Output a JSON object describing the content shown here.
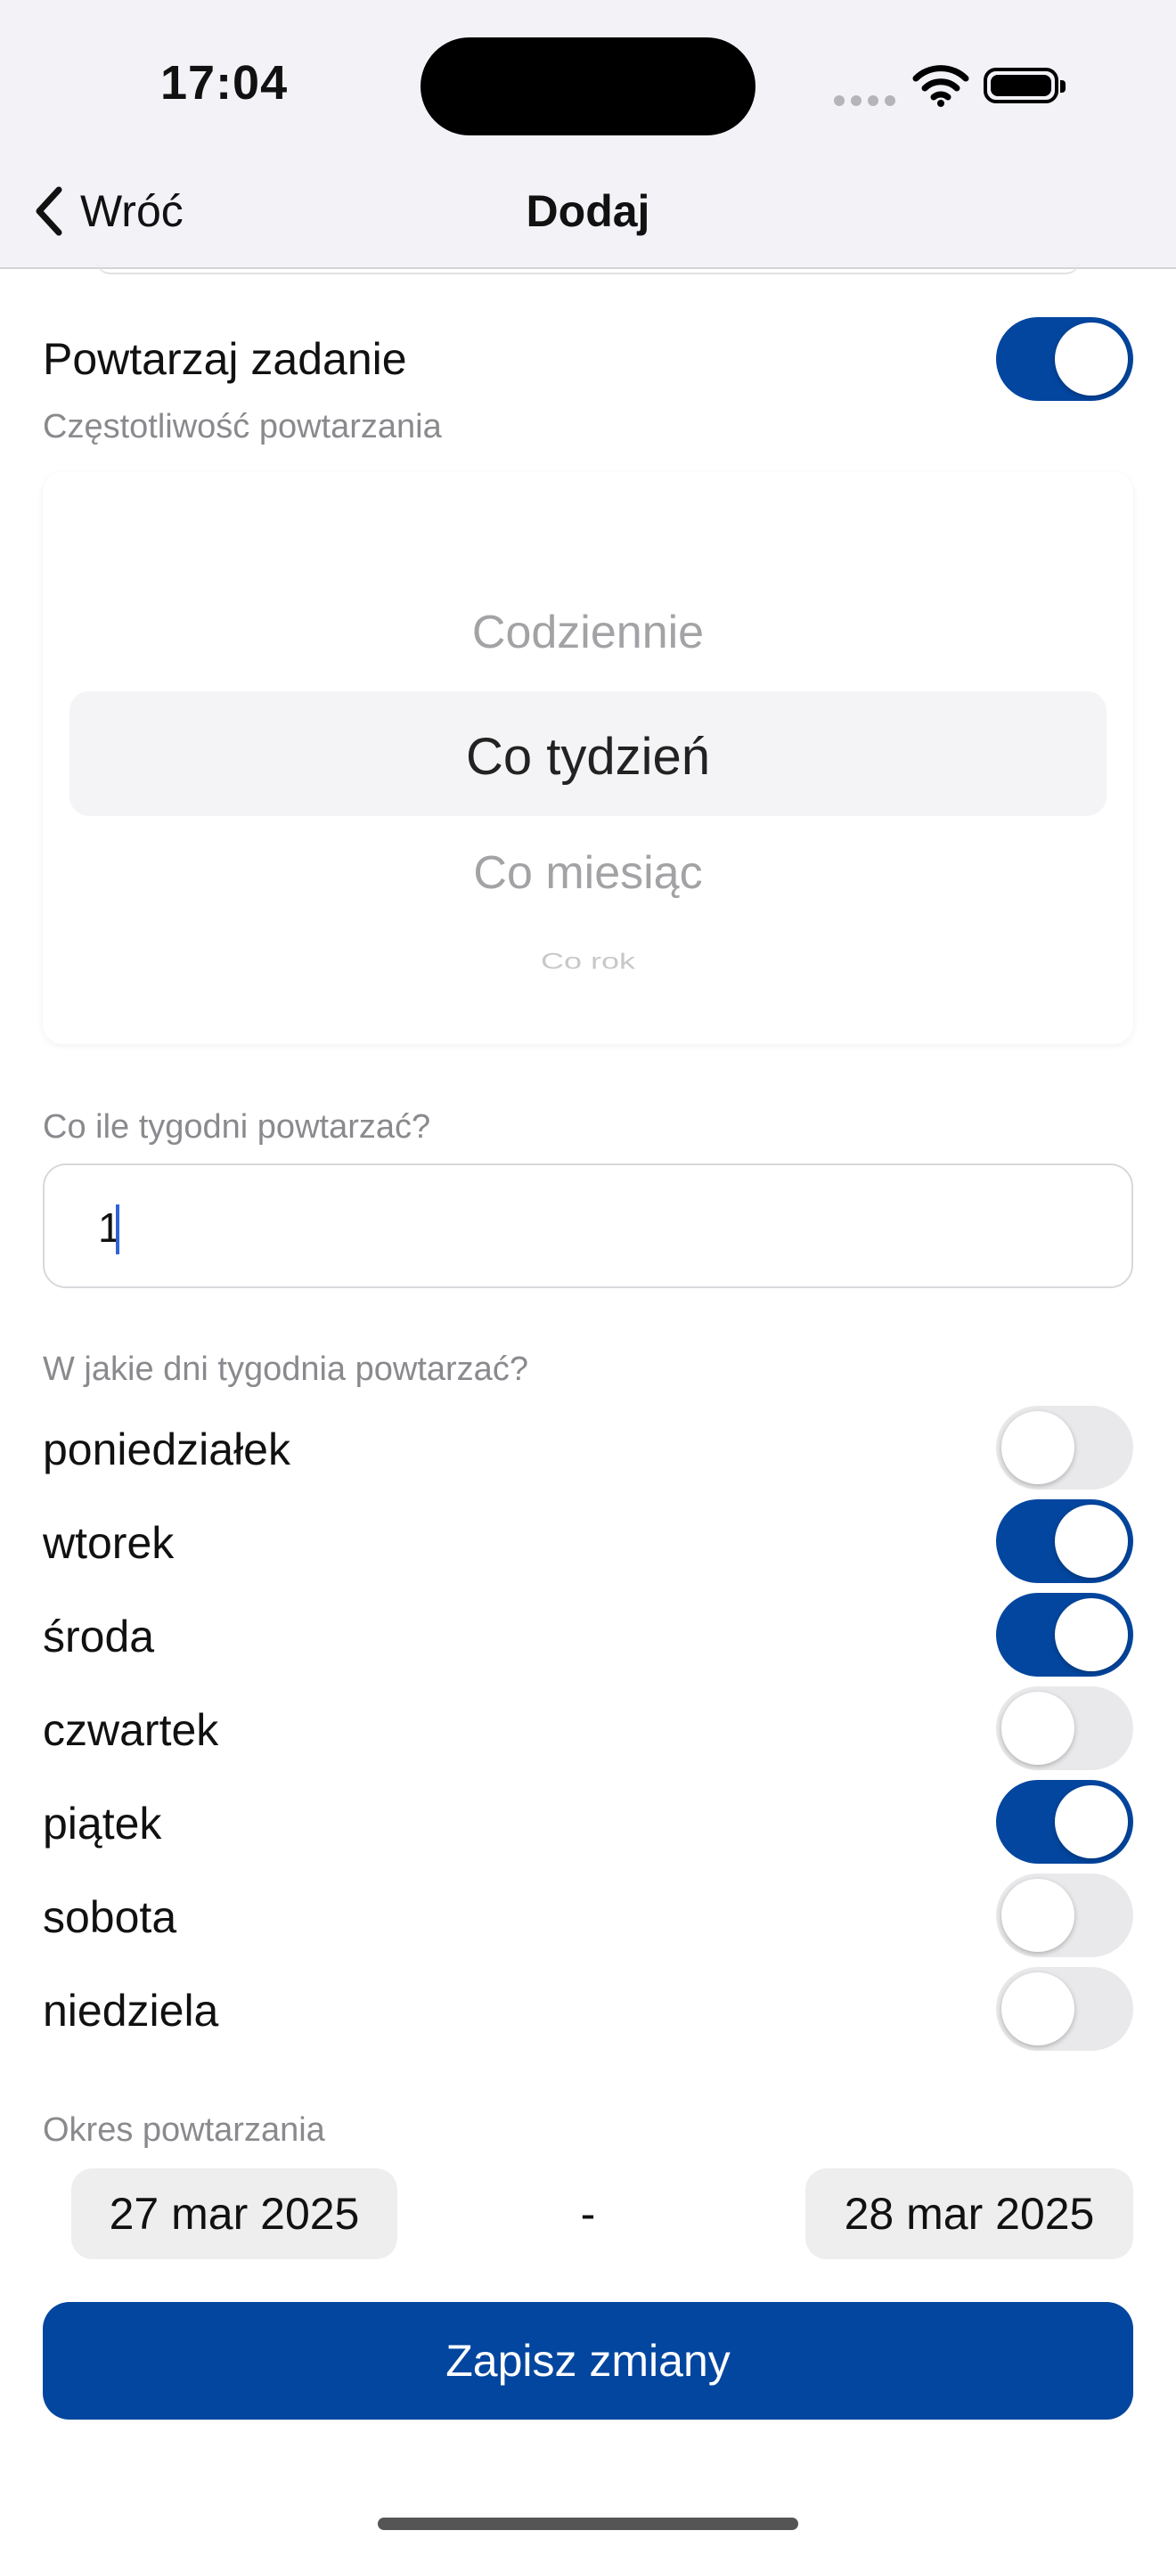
{
  "status_bar": {
    "time": "17:04"
  },
  "nav": {
    "back_label": "Wróć",
    "title": "Dodaj"
  },
  "repeat": {
    "label": "Powtarzaj zadanie",
    "enabled": true
  },
  "frequency": {
    "caption": "Częstotliwość powtarzania",
    "options": [
      "Codziennie",
      "Co tydzień",
      "Co miesiąc",
      "Co rok"
    ],
    "selected": "Co tydzień"
  },
  "interval": {
    "caption": "Co ile tygodni powtarzać?",
    "value": "1"
  },
  "weekdays": {
    "caption": "W jakie dni tygodnia powtarzać?",
    "days": [
      {
        "label": "poniedziałek",
        "on": false
      },
      {
        "label": "wtorek",
        "on": true
      },
      {
        "label": "środa",
        "on": true
      },
      {
        "label": "czwartek",
        "on": false
      },
      {
        "label": "piątek",
        "on": true
      },
      {
        "label": "sobota",
        "on": false
      },
      {
        "label": "niedziela",
        "on": false
      }
    ]
  },
  "period": {
    "caption": "Okres powtarzania",
    "start": "27 mar 2025",
    "separator": "-",
    "end": "28 mar 2025"
  },
  "save_button": {
    "label": "Zapisz zmiany"
  },
  "colors": {
    "accent": "#03469f",
    "toggle_off": "#e9e9eb",
    "caption": "#8a8a8e",
    "caret": "#2f63d9"
  }
}
